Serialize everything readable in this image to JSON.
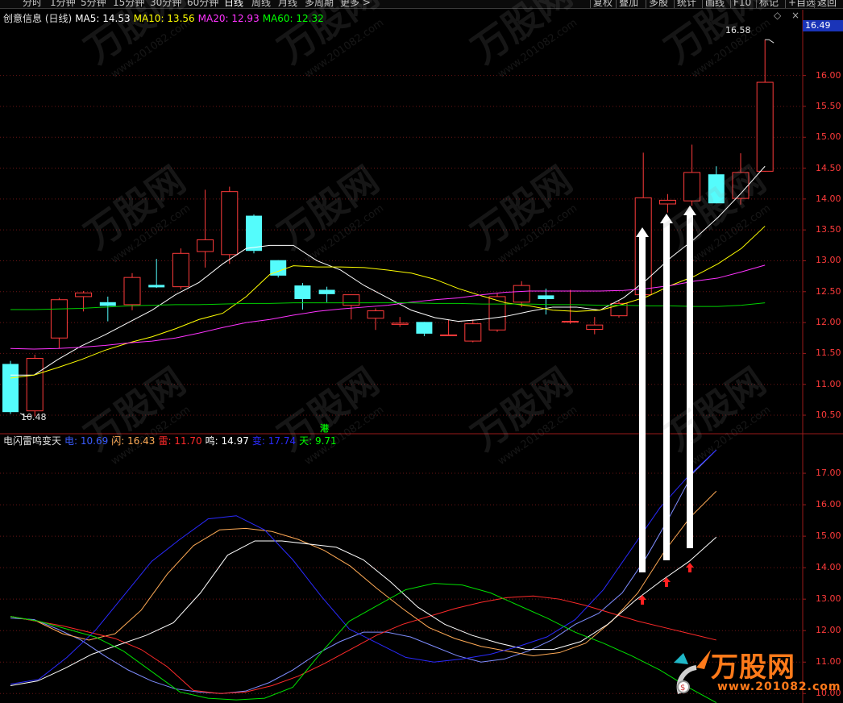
{
  "toolbar": {
    "left_items": [
      "分时",
      "1分钟",
      "5分钟",
      "15分钟",
      "30分钟",
      "60分钟",
      "日线",
      "周线",
      "月线",
      "多周期",
      "更多 >"
    ],
    "active": "日线",
    "right_items": [
      "复权",
      "叠加",
      "多股",
      "统计",
      "画线",
      "F10",
      "标记",
      "+自选",
      "返回"
    ]
  },
  "main_legend": {
    "title": "创意信息 (日线)",
    "items": [
      {
        "label": "MA5: 14.53",
        "color": "#ffffff"
      },
      {
        "label": "MA10: 13.56",
        "color": "#ffff00"
      },
      {
        "label": "MA20: 12.93",
        "color": "#ff33ff"
      },
      {
        "label": "MA60: 12.32",
        "color": "#00ff00"
      }
    ]
  },
  "price_axis": [
    "16.49",
    "16.00",
    "15.50",
    "15.00",
    "14.50",
    "14.00",
    "13.50",
    "13.00",
    "12.50",
    "12.00",
    "11.50",
    "11.00",
    "10.50"
  ],
  "current_price": "16.49",
  "price_high_tag": "16.58",
  "price_low_tag": "10.48",
  "hk_tag": "港",
  "indicator_legend": {
    "title": "电闪雷鸣变天",
    "items": [
      {
        "label": "电: 10.69",
        "color": "#3a5cff"
      },
      {
        "label": "闪: 16.43",
        "color": "#ffaa55"
      },
      {
        "label": "雷: 11.70",
        "color": "#ff2a2a"
      },
      {
        "label": "鸣: 14.97",
        "color": "#ffffff"
      },
      {
        "label": "变: 17.74",
        "color": "#2a2aff"
      },
      {
        "label": "天: 9.71",
        "color": "#00ff00"
      }
    ]
  },
  "indicator_axis": [
    "17.00",
    "16.00",
    "15.00",
    "14.00",
    "13.00",
    "12.00",
    "11.00",
    "10.00"
  ],
  "watermark": {
    "brand": "万股网",
    "url": "www.201082.com"
  },
  "chart_data": {
    "type": "candlestick",
    "ylim": [
      10.2,
      16.7
    ],
    "candles": [
      {
        "o": 11.33,
        "h": 11.38,
        "l": 10.52,
        "c": 10.55
      },
      {
        "o": 10.57,
        "h": 11.48,
        "l": 10.48,
        "c": 11.42
      },
      {
        "o": 11.75,
        "h": 12.4,
        "l": 11.58,
        "c": 12.37
      },
      {
        "o": 12.42,
        "h": 12.51,
        "l": 12.18,
        "c": 12.48
      },
      {
        "o": 12.33,
        "h": 12.42,
        "l": 12.02,
        "c": 12.27
      },
      {
        "o": 12.29,
        "h": 12.8,
        "l": 12.2,
        "c": 12.73
      },
      {
        "o": 12.61,
        "h": 13.03,
        "l": 12.56,
        "c": 12.57
      },
      {
        "o": 12.58,
        "h": 13.2,
        "l": 12.54,
        "c": 13.12
      },
      {
        "o": 13.15,
        "h": 14.15,
        "l": 12.89,
        "c": 13.34
      },
      {
        "o": 13.1,
        "h": 14.2,
        "l": 12.95,
        "c": 14.12
      },
      {
        "o": 13.73,
        "h": 13.75,
        "l": 13.12,
        "c": 13.16
      },
      {
        "o": 13.01,
        "h": 13.01,
        "l": 12.73,
        "c": 12.76
      },
      {
        "o": 12.6,
        "h": 12.64,
        "l": 12.21,
        "c": 12.38
      },
      {
        "o": 12.53,
        "h": 12.58,
        "l": 12.33,
        "c": 12.46
      },
      {
        "o": 12.28,
        "h": 12.45,
        "l": 12.05,
        "c": 12.45
      },
      {
        "o": 12.07,
        "h": 12.23,
        "l": 11.88,
        "c": 12.19
      },
      {
        "o": 11.97,
        "h": 12.09,
        "l": 11.93,
        "c": 11.99
      },
      {
        "o": 12.01,
        "h": 12.01,
        "l": 11.78,
        "c": 11.82
      },
      {
        "o": 11.8,
        "h": 12.05,
        "l": 11.8,
        "c": 11.8
      },
      {
        "o": 11.7,
        "h": 12.05,
        "l": 11.68,
        "c": 11.98
      },
      {
        "o": 11.88,
        "h": 12.47,
        "l": 11.85,
        "c": 12.42
      },
      {
        "o": 12.33,
        "h": 12.67,
        "l": 12.25,
        "c": 12.6
      },
      {
        "o": 12.44,
        "h": 12.55,
        "l": 12.13,
        "c": 12.38
      },
      {
        "o": 12.01,
        "h": 12.53,
        "l": 11.98,
        "c": 12.02
      },
      {
        "o": 11.89,
        "h": 12.09,
        "l": 11.81,
        "c": 11.96
      },
      {
        "o": 12.11,
        "h": 12.35,
        "l": 12.08,
        "c": 12.31
      },
      {
        "o": 12.45,
        "h": 14.75,
        "l": 12.38,
        "c": 14.02
      },
      {
        "o": 13.92,
        "h": 14.08,
        "l": 13.78,
        "c": 13.98
      },
      {
        "o": 13.97,
        "h": 14.88,
        "l": 13.89,
        "c": 14.43
      },
      {
        "o": 14.4,
        "h": 14.53,
        "l": 13.93,
        "c": 13.93
      },
      {
        "o": 14.01,
        "h": 14.74,
        "l": 13.91,
        "c": 14.43
      },
      {
        "o": 14.45,
        "h": 16.58,
        "l": 14.44,
        "c": 15.89
      }
    ],
    "ma": {
      "MA5": [
        11.15,
        11.15,
        11.4,
        11.62,
        11.8,
        12.0,
        12.2,
        12.45,
        12.65,
        12.95,
        13.2,
        13.25,
        13.25,
        13.0,
        12.85,
        12.6,
        12.4,
        12.2,
        12.08,
        12.02,
        12.05,
        12.1,
        12.18,
        12.25,
        12.25,
        12.2,
        12.4,
        12.7,
        13.05,
        13.35,
        13.7,
        14.1,
        14.53
      ],
      "MA10": [
        11.1,
        11.15,
        11.27,
        11.4,
        11.55,
        11.67,
        11.77,
        11.9,
        12.05,
        12.15,
        12.42,
        12.78,
        12.92,
        12.9,
        12.9,
        12.89,
        12.85,
        12.8,
        12.7,
        12.55,
        12.43,
        12.32,
        12.27,
        12.2,
        12.18,
        12.2,
        12.3,
        12.42,
        12.6,
        12.75,
        12.95,
        13.2,
        13.56
      ],
      "MA20": [
        11.58,
        11.57,
        11.58,
        11.6,
        11.63,
        11.67,
        11.7,
        11.75,
        11.83,
        11.92,
        12.0,
        12.05,
        12.12,
        12.18,
        12.22,
        12.25,
        12.28,
        12.33,
        12.37,
        12.4,
        12.45,
        12.49,
        12.51,
        12.51,
        12.51,
        12.51,
        12.52,
        12.55,
        12.6,
        12.67,
        12.72,
        12.82,
        12.93
      ],
      "MA60": [
        12.21,
        12.21,
        12.22,
        12.23,
        12.25,
        12.27,
        12.28,
        12.29,
        12.29,
        12.3,
        12.31,
        12.31,
        12.32,
        12.32,
        12.32,
        12.32,
        12.32,
        12.32,
        12.31,
        12.31,
        12.3,
        12.3,
        12.3,
        12.29,
        12.29,
        12.28,
        12.28,
        12.27,
        12.27,
        12.26,
        12.26,
        12.28,
        12.32
      ]
    },
    "indicator": {
      "ylim": [
        9.7,
        18.0
      ],
      "电": [
        12.4,
        12.35,
        12.05,
        11.7,
        11.2,
        10.75,
        10.4,
        10.15,
        10.05,
        10.0,
        10.08,
        10.35,
        10.75,
        11.25,
        11.65,
        11.95,
        11.95,
        11.8,
        11.5,
        11.2,
        11.0,
        11.1,
        11.35,
        11.7,
        12.2,
        12.55,
        13.2,
        14.3,
        15.6,
        17.0,
        17.74
      ],
      "闪": [
        12.45,
        12.3,
        11.9,
        11.7,
        11.9,
        12.65,
        13.8,
        14.7,
        15.2,
        15.25,
        15.15,
        14.9,
        14.55,
        14.05,
        13.35,
        12.7,
        12.1,
        11.75,
        11.5,
        11.35,
        11.2,
        11.3,
        11.6,
        12.3,
        13.2,
        14.5,
        15.6,
        16.43
      ],
      "雷": [
        12.45,
        12.3,
        12.15,
        11.95,
        11.75,
        11.4,
        10.85,
        10.1,
        10.0,
        10.05,
        10.25,
        10.55,
        10.95,
        11.4,
        11.85,
        12.2,
        12.45,
        12.7,
        12.9,
        13.05,
        13.1,
        13.0,
        12.8,
        12.55,
        12.3,
        12.1,
        11.9,
        11.7
      ],
      "鸣": [
        10.25,
        10.4,
        10.8,
        11.25,
        11.55,
        11.85,
        12.25,
        13.2,
        14.4,
        14.85,
        14.85,
        14.75,
        14.65,
        14.25,
        13.55,
        12.75,
        12.2,
        11.85,
        11.6,
        11.4,
        11.4,
        11.65,
        12.2,
        12.95,
        13.6,
        14.2,
        14.97
      ],
      "变": [
        10.3,
        10.45,
        11.15,
        12.0,
        13.1,
        14.2,
        14.9,
        15.55,
        15.65,
        15.2,
        14.25,
        13.1,
        12.05,
        11.6,
        11.15,
        11.0,
        11.1,
        11.25,
        11.5,
        11.8,
        12.35,
        13.3,
        14.6,
        15.9,
        16.9,
        17.74
      ],
      "天": [
        12.45,
        12.3,
        12.05,
        11.8,
        11.35,
        10.7,
        10.05,
        9.85,
        9.8,
        9.85,
        10.2,
        11.3,
        12.3,
        12.8,
        13.3,
        13.5,
        13.45,
        13.2,
        12.8,
        12.4,
        11.95,
        11.6,
        11.2,
        10.75,
        10.2,
        9.71
      ]
    }
  }
}
